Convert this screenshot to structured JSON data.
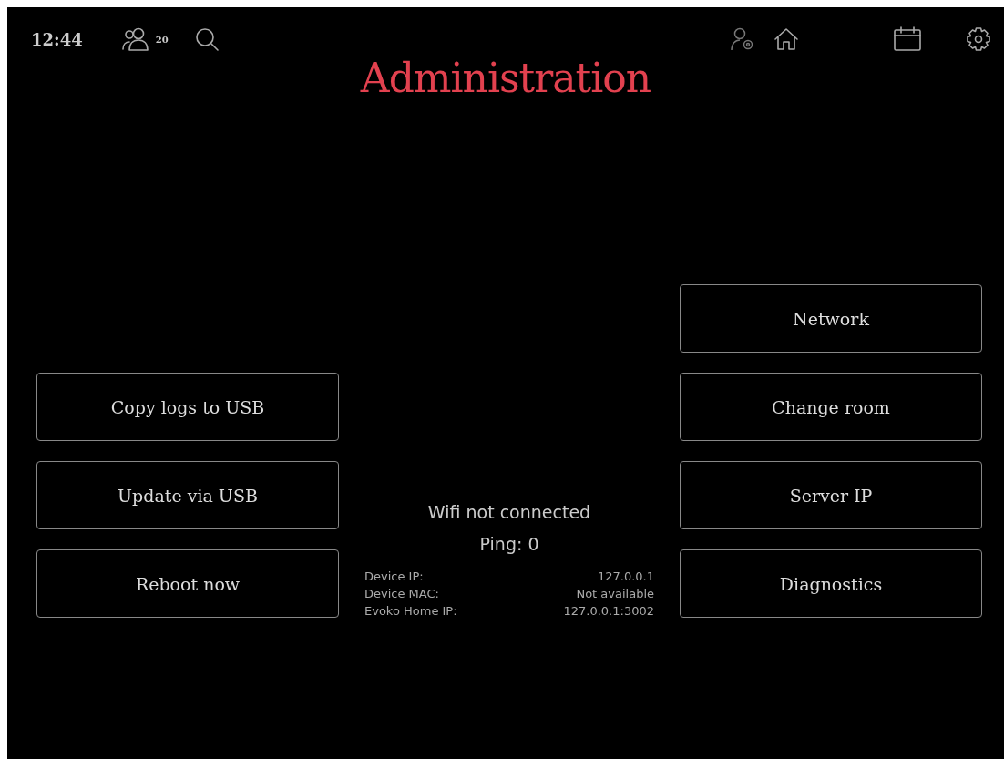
{
  "status_bar": {
    "time": "12:44",
    "people_count": "20"
  },
  "title": "Administration",
  "left_buttons": [
    "Copy logs to USB",
    "Update via USB",
    "Reboot now"
  ],
  "right_buttons": [
    "Network",
    "Change room",
    "Server IP",
    "Diagnostics"
  ],
  "connection": {
    "wifi": "Wifi not connected",
    "ping": "Ping: 0"
  },
  "device_info": [
    {
      "label": "Device IP:",
      "value": "127.0.0.1"
    },
    {
      "label": "Device MAC:",
      "value": "Not available"
    },
    {
      "label": "Evoko Home IP:",
      "value": "127.0.0.1:3002"
    }
  ]
}
